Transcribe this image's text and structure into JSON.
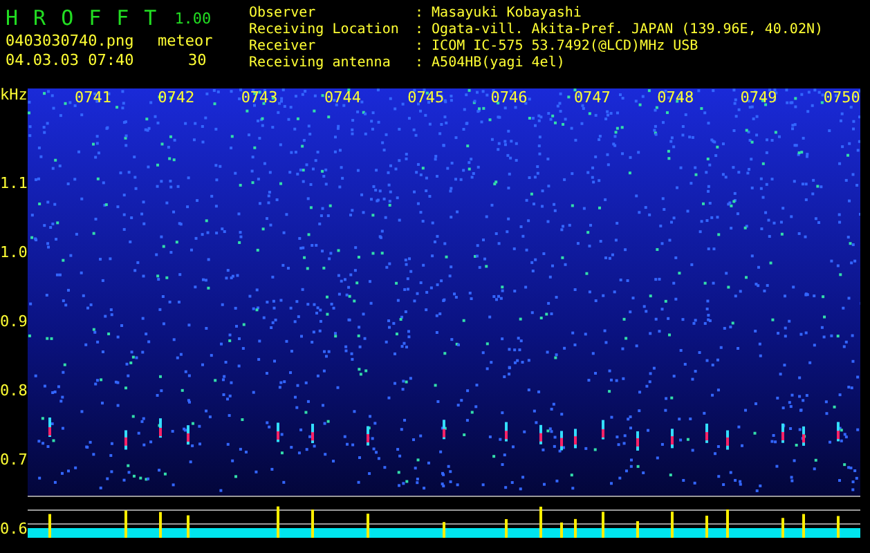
{
  "header": {
    "title_letters": [
      "H",
      "R",
      "O",
      "F",
      "F",
      "T"
    ],
    "version": "1.00",
    "filename": "0403030740.png",
    "datetime": "04.03.03 07:40",
    "counter_label": "meteor",
    "counter_value": "30"
  },
  "info": [
    {
      "label": "Observer",
      "value": ": Masayuki Kobayashi"
    },
    {
      "label": "Receiving Location",
      "value": ": Ogata-vill. Akita-Pref. JAPAN (139.96E, 40.02N)"
    },
    {
      "label": "Receiver",
      "value": ": ICOM IC-575 53.7492(@LCD)MHz USB"
    },
    {
      "label": "Receiving antenna",
      "value": ": A504HB(yagi 4el)"
    }
  ],
  "plot": {
    "unit": "kHz",
    "y_labels": [
      "1.1",
      "1.0",
      "0.9",
      "0.8",
      "0.7",
      "0.6"
    ],
    "time_labels": [
      "0741",
      "0742",
      "0743",
      "0744",
      "0745",
      "0746",
      "0747",
      "0748",
      "0749",
      "0750"
    ]
  }
}
